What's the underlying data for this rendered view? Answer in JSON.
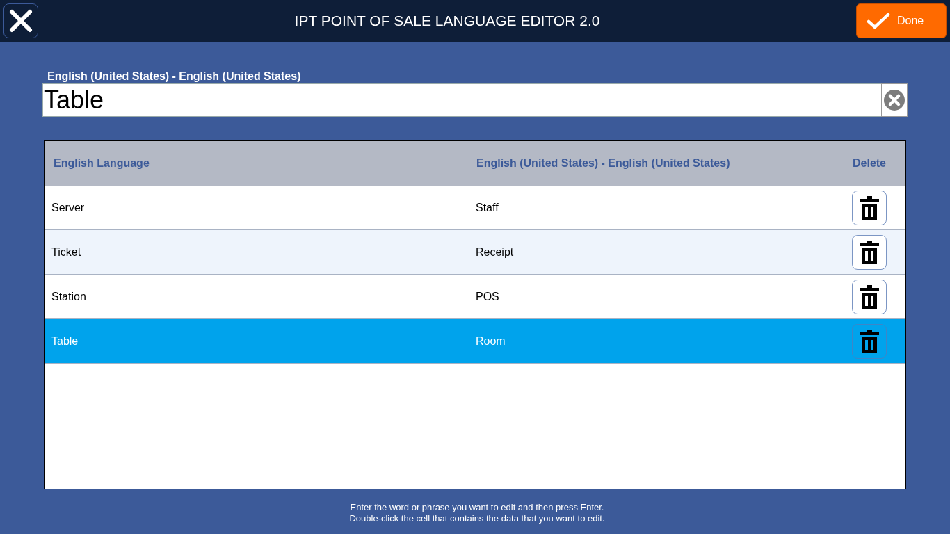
{
  "header": {
    "title": "IPT POINT OF SALE LANGUAGE EDITOR 2.0",
    "done_label": "Done"
  },
  "search": {
    "label": "English (United States) - English (United States)",
    "value": "Table"
  },
  "table": {
    "columns": [
      "English Language",
      "English (United States) - English (United States)",
      "Delete"
    ],
    "rows": [
      {
        "source": "Server",
        "translation": "Staff",
        "selected": false
      },
      {
        "source": "Ticket",
        "translation": "Receipt",
        "selected": false
      },
      {
        "source": "Station",
        "translation": "POS",
        "selected": false
      },
      {
        "source": "Table",
        "translation": "Room",
        "selected": true
      }
    ]
  },
  "instructions": [
    "Enter the word or phrase you want to edit and then press Enter.",
    "Double-click the cell that contains the data that you want to edit."
  ]
}
